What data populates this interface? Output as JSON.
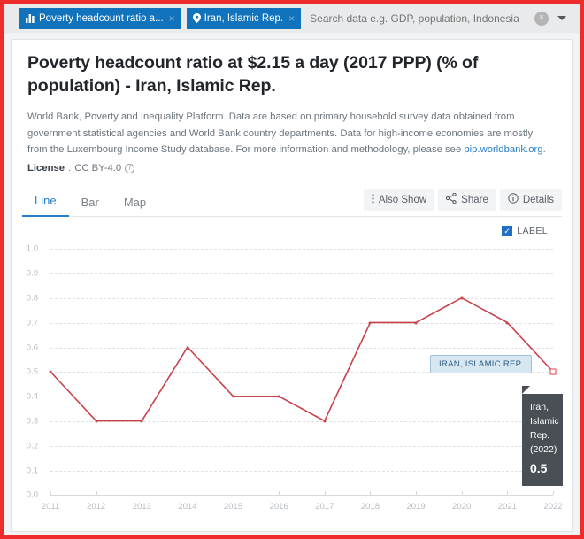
{
  "search": {
    "placeholder": "Search data e.g. GDP, population, Indonesia",
    "value": "",
    "chips": [
      {
        "label": "Poverty headcount ratio a...",
        "icon": "bar-chart-icon",
        "close": "×"
      },
      {
        "label": "Iran, Islamic Rep.",
        "icon": "location-pin-icon",
        "close": "×"
      }
    ],
    "clear_label": "×",
    "dropdown_label": "▾"
  },
  "header": {
    "title": "Poverty headcount ratio at $2.15 a day (2017 PPP) (% of population) - Iran, Islamic Rep.",
    "description_before_link": "World Bank, Poverty and Inequality Platform. Data are based on primary household survey data obtained from government statistical agencies and World Bank country departments. Data for high-income economies are mostly from the Luxembourg Income Study database. For more information and methodology, please see ",
    "description_link": "pip.worldbank.org",
    "description_after_link": ".",
    "license_label": "License",
    "license_separator": " : ",
    "license_value": "CC BY-4.0",
    "license_info_icon": "i"
  },
  "tabs": [
    {
      "label": "Line",
      "active": true
    },
    {
      "label": "Bar",
      "active": false
    },
    {
      "label": "Map",
      "active": false
    }
  ],
  "toolbar": [
    {
      "label": "Also Show",
      "icon": "vertical-dots-icon"
    },
    {
      "label": "Share",
      "icon": "share-icon"
    },
    {
      "label": "Details",
      "icon": "info-icon"
    }
  ],
  "chart_controls": {
    "label_checkbox_text": "LABEL",
    "label_checkbox_checked": true,
    "checkmark": "✓"
  },
  "annotations": {
    "series_label": "IRAN, ISLAMIC REP.",
    "tooltip_name": "Iran, Islamic Rep.",
    "tooltip_year": "(2022)",
    "tooltip_value": "0.5"
  },
  "colors": {
    "accent_blue": "#2a7fc9",
    "chip_blue": "#1273bd",
    "line_red": "#c9424a",
    "frame_red": "#ef2b2b",
    "tooltip_bg": "#4a4f55",
    "series_label_bg": "#d6e7f2"
  },
  "chart_data": {
    "type": "line",
    "title": "Poverty headcount ratio at $2.15 a day (2017 PPP) (% of population) - Iran, Islamic Rep.",
    "xlabel": "",
    "ylabel": "",
    "grid": true,
    "legend": "none",
    "x": [
      2011,
      2012,
      2013,
      2014,
      2015,
      2016,
      2017,
      2018,
      2019,
      2020,
      2021,
      2022
    ],
    "categories": [
      "2011",
      "2012",
      "2013",
      "2014",
      "2015",
      "2016",
      "2017",
      "2018",
      "2019",
      "2020",
      "2021",
      "2022"
    ],
    "ylim": [
      0.0,
      1.0
    ],
    "yticks": [
      "0.0",
      "0.1",
      "0.2",
      "0.3",
      "0.4",
      "0.5",
      "0.6",
      "0.7",
      "0.8",
      "0.9",
      "1.0"
    ],
    "series": [
      {
        "name": "Iran, Islamic Rep.",
        "color": "#c9424a",
        "values": [
          0.5,
          0.3,
          0.3,
          0.6,
          0.4,
          0.4,
          0.3,
          0.7,
          0.7,
          0.8,
          0.7,
          0.5
        ]
      }
    ]
  }
}
